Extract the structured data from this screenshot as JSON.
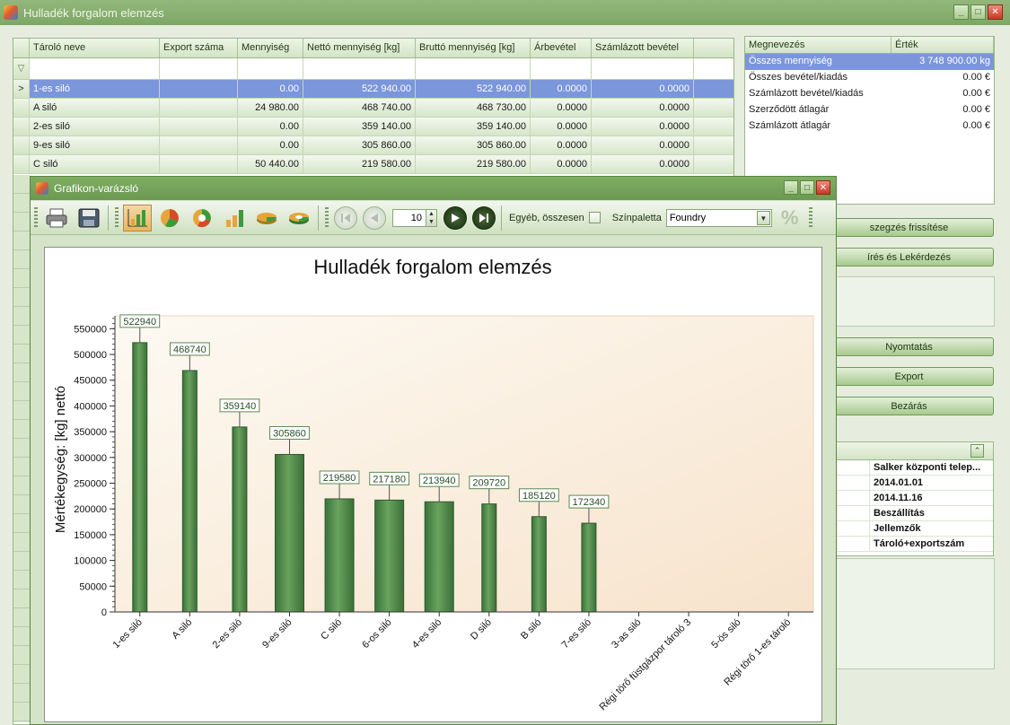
{
  "window": {
    "title": "Hulladék forgalom elemzés"
  },
  "grid": {
    "columns": [
      "Tároló neve",
      "Export száma",
      "Mennyiség",
      "Nettó mennyiség [kg]",
      "Bruttó mennyiség [kg]",
      "Árbevétel",
      "Számlázott bevétel"
    ],
    "rows": [
      {
        "name": "1-es siló",
        "export": "",
        "qty": "0.00",
        "net": "522 940.00",
        "gross": "522 940.00",
        "revenue": "0.0000",
        "billed": "0.0000"
      },
      {
        "name": "A siló",
        "export": "",
        "qty": "24 980.00",
        "net": "468 740.00",
        "gross": "468 730.00",
        "revenue": "0.0000",
        "billed": "0.0000"
      },
      {
        "name": "2-es siló",
        "export": "",
        "qty": "0.00",
        "net": "359 140.00",
        "gross": "359 140.00",
        "revenue": "0.0000",
        "billed": "0.0000"
      },
      {
        "name": "9-es siló",
        "export": "",
        "qty": "0.00",
        "net": "305 860.00",
        "gross": "305 860.00",
        "revenue": "0.0000",
        "billed": "0.0000"
      },
      {
        "name": "C siló",
        "export": "",
        "qty": "50 440.00",
        "net": "219 580.00",
        "gross": "219 580.00",
        "revenue": "0.0000",
        "billed": "0.0000"
      }
    ]
  },
  "props": {
    "headers": [
      "Megnevezés",
      "Érték"
    ],
    "rows": [
      {
        "k": "Összes mennyiség",
        "v": "3 748 900.00 kg"
      },
      {
        "k": "Összes bevétel/kiadás",
        "v": "0.00 €"
      },
      {
        "k": "Számlázott bevétel/kiadás",
        "v": "0.00 €"
      },
      {
        "k": "Szerződött átlagár",
        "v": "0.00 €"
      },
      {
        "k": "Számlázott átlagár",
        "v": "0.00 €"
      }
    ]
  },
  "buttons": {
    "refresh": "szegzés frissítése",
    "query": "írés és Lekérdezés",
    "print": "Nyomtatás",
    "export": "Export",
    "close": "Bezárás"
  },
  "info": {
    "values": [
      "Salker központi telep...",
      "2014.01.01",
      "2014.11.16",
      "Beszállítás",
      "Jellemzők",
      "Tároló+exportszám"
    ]
  },
  "chart_window": {
    "title": "Grafikon-varázsló",
    "page_value": "10",
    "other_total_label": "Egyéb, összesen",
    "palette_label": "Színpaletta",
    "palette_value": "Foundry",
    "percent_symbol": "%"
  },
  "colors": {
    "bar": "#4f8a46",
    "selection": "#7b96da",
    "title_bar": "#7ea766"
  },
  "chart_data": {
    "type": "bar",
    "title": "Hulladék forgalom elemzés",
    "xlabel": "",
    "ylabel": "Mértékegység: [kg] nettó",
    "categories": [
      "1-es siló",
      "A siló",
      "2-es siló",
      "9-es siló",
      "C siló",
      "6-os siló",
      "4-es siló",
      "D siló",
      "B siló",
      "7-es siló",
      "3-as siló",
      "Régi törő füstgázpor tároló 3",
      "5-ös siló",
      "Régi törő 1-es tároló"
    ],
    "values": [
      522940,
      468740,
      359140,
      305860,
      219580,
      217180,
      213940,
      209720,
      185120,
      172340,
      0,
      0,
      0,
      0
    ],
    "data_labels": [
      "522940",
      "468740",
      "359140",
      "305860",
      "219580",
      "217180",
      "213940",
      "209720",
      "185120",
      "172340",
      "",
      "",
      "",
      ""
    ],
    "ylim": [
      0,
      575000
    ],
    "yticks": [
      0,
      50000,
      100000,
      150000,
      200000,
      250000,
      300000,
      350000,
      400000,
      450000,
      500000,
      550000
    ],
    "grid": false,
    "legend": "none"
  }
}
